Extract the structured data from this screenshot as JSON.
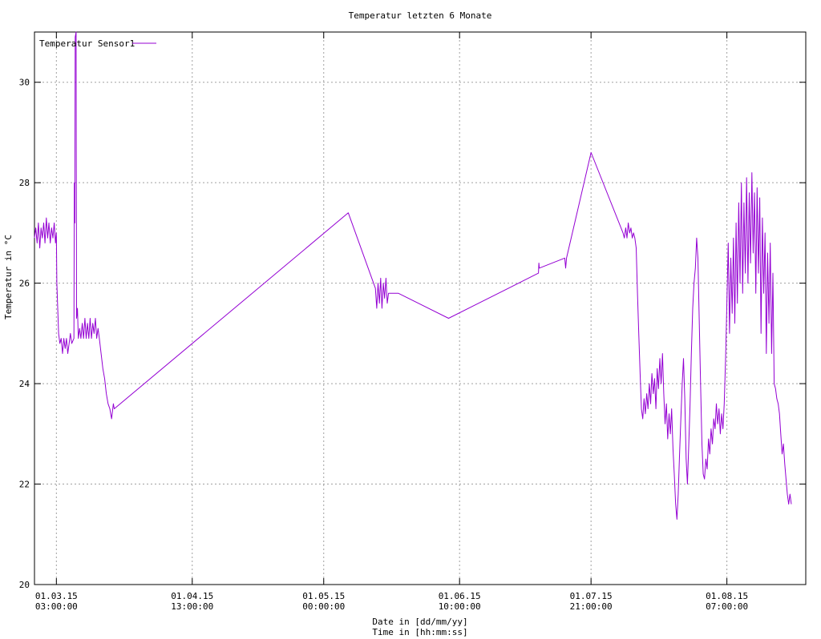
{
  "chart_data": {
    "type": "line",
    "title": "Temperatur letzten 6 Monate",
    "xlabel": "Date in [dd/mm/yy]",
    "xlabel2": "Time in [hh:mm:ss]",
    "ylabel": "Temperatur in °C",
    "ylim": [
      20,
      31
    ],
    "yticks": [
      20,
      22,
      24,
      26,
      28,
      30
    ],
    "xlim": [
      0,
      176
    ],
    "xticks": [
      {
        "x": 5,
        "date": "01.03.15",
        "time": "03:00:00"
      },
      {
        "x": 36,
        "date": "01.04.15",
        "time": "13:00:00"
      },
      {
        "x": 66,
        "date": "01.05.15",
        "time": "00:00:00"
      },
      {
        "x": 97,
        "date": "01.06.15",
        "time": "10:00:00"
      },
      {
        "x": 127,
        "date": "01.07.15",
        "time": "21:00:00"
      },
      {
        "x": 158,
        "date": "01.08.15",
        "time": "07:00:00"
      }
    ],
    "grid": true,
    "legend_position": "top-left",
    "color": "#9400d3",
    "series": [
      {
        "name": "Temperatur Sensor1",
        "points": [
          [
            0.0,
            26.9
          ],
          [
            0.3,
            27.1
          ],
          [
            0.6,
            26.8
          ],
          [
            0.9,
            27.2
          ],
          [
            1.2,
            26.7
          ],
          [
            1.5,
            27.1
          ],
          [
            1.8,
            26.9
          ],
          [
            2.1,
            27.2
          ],
          [
            2.4,
            26.8
          ],
          [
            2.7,
            27.3
          ],
          [
            3.0,
            26.9
          ],
          [
            3.3,
            27.2
          ],
          [
            3.6,
            26.8
          ],
          [
            3.9,
            27.1
          ],
          [
            4.2,
            26.9
          ],
          [
            4.5,
            27.2
          ],
          [
            4.8,
            26.8
          ],
          [
            5.0,
            27.0
          ],
          [
            5.1,
            26.0
          ],
          [
            5.3,
            25.5
          ],
          [
            5.5,
            25.0
          ],
          [
            5.8,
            24.8
          ],
          [
            6.1,
            24.9
          ],
          [
            6.4,
            24.6
          ],
          [
            6.7,
            24.9
          ],
          [
            7.0,
            24.7
          ],
          [
            7.3,
            24.9
          ],
          [
            7.6,
            24.6
          ],
          [
            7.9,
            24.8
          ],
          [
            8.2,
            25.0
          ],
          [
            8.5,
            24.8
          ],
          [
            9.0,
            24.9
          ],
          [
            9.1,
            28.0
          ],
          [
            9.2,
            27.2
          ],
          [
            9.3,
            30.9
          ],
          [
            9.5,
            31.0
          ],
          [
            9.6,
            25.3
          ],
          [
            9.8,
            25.5
          ],
          [
            10.0,
            24.9
          ],
          [
            10.3,
            25.1
          ],
          [
            10.6,
            24.9
          ],
          [
            10.9,
            25.2
          ],
          [
            11.2,
            24.9
          ],
          [
            11.5,
            25.3
          ],
          [
            11.8,
            24.9
          ],
          [
            12.1,
            25.2
          ],
          [
            12.4,
            24.9
          ],
          [
            12.7,
            25.3
          ],
          [
            13.0,
            24.9
          ],
          [
            13.3,
            25.2
          ],
          [
            13.6,
            25.0
          ],
          [
            13.9,
            25.3
          ],
          [
            14.2,
            24.9
          ],
          [
            14.5,
            25.1
          ],
          [
            14.8,
            24.9
          ],
          [
            15.2,
            24.6
          ],
          [
            15.6,
            24.3
          ],
          [
            16.0,
            24.1
          ],
          [
            16.4,
            23.8
          ],
          [
            16.8,
            23.6
          ],
          [
            17.2,
            23.5
          ],
          [
            17.6,
            23.3
          ],
          [
            18.0,
            23.6
          ],
          [
            18.2,
            23.5
          ],
          [
            71.6,
            27.4
          ],
          [
            77.8,
            25.9
          ],
          [
            78.1,
            25.5
          ],
          [
            78.4,
            26.0
          ],
          [
            78.7,
            25.6
          ],
          [
            79.0,
            26.1
          ],
          [
            79.3,
            25.5
          ],
          [
            79.6,
            26.0
          ],
          [
            79.9,
            25.7
          ],
          [
            80.2,
            26.1
          ],
          [
            80.5,
            25.6
          ],
          [
            80.8,
            25.8
          ],
          [
            82.5,
            25.8
          ],
          [
            83.0,
            25.8
          ],
          [
            94.5,
            25.3
          ],
          [
            115.0,
            26.2
          ],
          [
            115.1,
            26.4
          ],
          [
            115.2,
            26.3
          ],
          [
            121.0,
            26.5
          ],
          [
            121.2,
            26.3
          ],
          [
            121.4,
            26.5
          ],
          [
            127.0,
            28.6
          ],
          [
            134.3,
            27.0
          ],
          [
            134.6,
            26.9
          ],
          [
            134.9,
            27.1
          ],
          [
            135.2,
            26.9
          ],
          [
            135.5,
            27.2
          ],
          [
            135.8,
            27.0
          ],
          [
            136.1,
            27.1
          ],
          [
            136.4,
            26.9
          ],
          [
            136.7,
            27.0
          ],
          [
            137.0,
            26.9
          ],
          [
            137.3,
            26.7
          ],
          [
            137.6,
            25.8
          ],
          [
            137.9,
            25.0
          ],
          [
            138.2,
            24.2
          ],
          [
            138.5,
            23.5
          ],
          [
            138.8,
            23.3
          ],
          [
            139.1,
            23.7
          ],
          [
            139.4,
            23.4
          ],
          [
            139.7,
            23.8
          ],
          [
            140.0,
            23.5
          ],
          [
            140.3,
            24.0
          ],
          [
            140.6,
            23.6
          ],
          [
            140.9,
            24.2
          ],
          [
            141.2,
            23.8
          ],
          [
            141.5,
            24.1
          ],
          [
            141.8,
            23.5
          ],
          [
            142.1,
            24.3
          ],
          [
            142.4,
            23.9
          ],
          [
            142.7,
            24.5
          ],
          [
            143.0,
            24.0
          ],
          [
            143.3,
            24.6
          ],
          [
            143.6,
            23.8
          ],
          [
            143.9,
            23.2
          ],
          [
            144.2,
            23.6
          ],
          [
            144.5,
            22.9
          ],
          [
            144.8,
            23.4
          ],
          [
            145.1,
            23.0
          ],
          [
            145.4,
            23.5
          ],
          [
            145.7,
            22.7
          ],
          [
            146.0,
            22.2
          ],
          [
            146.3,
            21.6
          ],
          [
            146.6,
            21.3
          ],
          [
            146.9,
            21.8
          ],
          [
            147.2,
            22.6
          ],
          [
            147.5,
            23.3
          ],
          [
            147.8,
            24.0
          ],
          [
            148.1,
            24.5
          ],
          [
            148.4,
            23.7
          ],
          [
            148.7,
            22.5
          ],
          [
            149.0,
            22.0
          ],
          [
            149.3,
            22.8
          ],
          [
            149.6,
            23.6
          ],
          [
            149.9,
            24.6
          ],
          [
            150.2,
            25.5
          ],
          [
            150.5,
            26.0
          ],
          [
            150.8,
            26.3
          ],
          [
            151.1,
            26.9
          ],
          [
            151.4,
            26.5
          ],
          [
            151.7,
            25.2
          ],
          [
            152.0,
            24.0
          ],
          [
            152.3,
            22.8
          ],
          [
            152.6,
            22.2
          ],
          [
            152.9,
            22.1
          ],
          [
            153.2,
            22.5
          ],
          [
            153.5,
            22.3
          ],
          [
            153.8,
            22.9
          ],
          [
            154.1,
            22.6
          ],
          [
            154.4,
            23.1
          ],
          [
            154.7,
            22.8
          ],
          [
            155.0,
            23.3
          ],
          [
            155.3,
            23.1
          ],
          [
            155.6,
            23.6
          ],
          [
            155.9,
            23.2
          ],
          [
            156.2,
            23.5
          ],
          [
            156.5,
            23.0
          ],
          [
            156.8,
            23.4
          ],
          [
            157.1,
            23.1
          ],
          [
            157.4,
            23.6
          ],
          [
            157.7,
            24.5
          ],
          [
            158.0,
            25.6
          ],
          [
            158.3,
            26.8
          ],
          [
            158.6,
            25.0
          ],
          [
            158.9,
            26.5
          ],
          [
            159.2,
            25.4
          ],
          [
            159.5,
            26.9
          ],
          [
            159.8,
            25.2
          ],
          [
            160.1,
            27.2
          ],
          [
            160.4,
            25.6
          ],
          [
            160.7,
            27.6
          ],
          [
            161.0,
            26.0
          ],
          [
            161.3,
            28.0
          ],
          [
            161.6,
            25.8
          ],
          [
            161.9,
            27.6
          ],
          [
            162.2,
            26.2
          ],
          [
            162.5,
            28.1
          ],
          [
            162.8,
            26.0
          ],
          [
            163.1,
            27.8
          ],
          [
            163.4,
            26.4
          ],
          [
            163.7,
            28.2
          ],
          [
            164.0,
            26.6
          ],
          [
            164.3,
            27.8
          ],
          [
            164.6,
            25.8
          ],
          [
            164.9,
            27.9
          ],
          [
            165.2,
            26.2
          ],
          [
            165.5,
            27.7
          ],
          [
            165.8,
            25.0
          ],
          [
            166.1,
            27.3
          ],
          [
            166.4,
            25.8
          ],
          [
            166.7,
            27.0
          ],
          [
            167.0,
            24.6
          ],
          [
            167.3,
            26.6
          ],
          [
            167.6,
            25.2
          ],
          [
            167.9,
            26.8
          ],
          [
            168.2,
            24.6
          ],
          [
            168.5,
            26.2
          ],
          [
            168.8,
            24.0
          ],
          [
            169.1,
            23.9
          ],
          [
            169.4,
            23.7
          ],
          [
            169.7,
            23.6
          ],
          [
            170.0,
            23.4
          ],
          [
            170.3,
            23.0
          ],
          [
            170.6,
            22.6
          ],
          [
            170.9,
            22.8
          ],
          [
            171.2,
            22.4
          ],
          [
            171.5,
            22.1
          ],
          [
            171.8,
            21.8
          ],
          [
            172.1,
            21.6
          ],
          [
            172.4,
            21.8
          ],
          [
            172.7,
            21.6
          ]
        ]
      }
    ]
  }
}
